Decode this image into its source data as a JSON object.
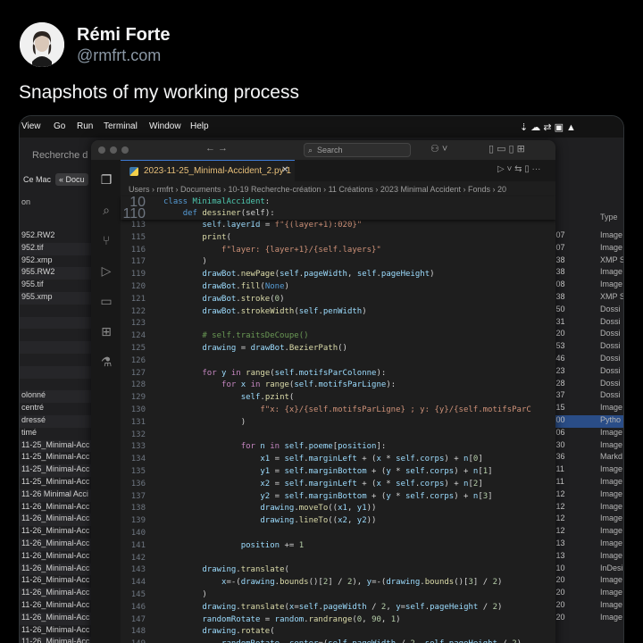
{
  "tweet": {
    "author_name": "Rémi Forte",
    "author_handle": "@rmfrt.com",
    "text": "Snapshots of my working process"
  },
  "menubar": {
    "items": [
      "View",
      "Go",
      "Run",
      "Terminal",
      "Window",
      "Help"
    ]
  },
  "finder": {
    "title": "Recherche d",
    "location_mac": "Ce Mac",
    "location_doc": "« Docu",
    "column_partial": "on",
    "type_header": "Type",
    "names": [
      "952.RW2",
      "952.tif",
      "952.xmp",
      "955.RW2",
      "955.tif",
      "955.xmp",
      "",
      "",
      "",
      "",
      "",
      "",
      "",
      "olonné",
      "centré",
      "dressé",
      "timé",
      "11-25_Minimal-Acc",
      "11-25_Minimal-Acc",
      "11-25_Minimal-Acc",
      "11-25_Minimal-Acc",
      "11-26 Minimal Acci",
      "11-26_Minimal-Acc",
      "11-26_Minimal-Acc",
      "11-26_Minimal-Acc",
      "11-26_Minimal-Acc",
      "11-26_Minimal-Acc",
      "11-26_Minimal-Acc",
      "11-26_Minimal-Acc",
      "11-26_Minimal-Acc",
      "11-26_Minimal-Acc",
      "11-26_Minimal-Acc",
      "11-26_Minimal-Acc",
      "11-26_Minimal-Acc",
      "11-26_Minimal-Acc"
    ],
    "times": [
      ":07",
      ":07",
      ":38",
      ":38",
      ":08",
      ":38",
      ":50",
      ":31",
      ":20",
      ":53",
      ":46",
      ":23",
      ":28",
      ":37",
      ":15",
      ":00",
      ":06",
      ":30",
      ":36",
      ":11",
      ":11",
      ":12",
      ":12",
      ":12",
      ":12",
      ":13",
      ":13",
      ":10",
      ":20",
      ":20",
      ":20",
      ":20"
    ],
    "types": [
      "Image",
      "Image",
      "XMP S",
      "Image",
      "Image",
      "XMP S",
      "Dossi",
      "Dossi",
      "Dossi",
      "Dossi",
      "Dossi",
      "Dossi",
      "Dossi",
      "Dossi",
      "Image",
      "Pytho",
      "Image",
      "Image",
      "Markd",
      "Image",
      "Image",
      "Image",
      "Image",
      "Image",
      "Image",
      "Image",
      "Image",
      "InDesi",
      "Image",
      "Image",
      "Image",
      "Image"
    ]
  },
  "vscode": {
    "search_placeholder": "Search",
    "tab_label": "2023-11-25_Minimal-Accident_2.py 1",
    "breadcrumb": "Users › rmfrt › Documents › 10-19 Recherche-création › 11 Créations › 2023 Minimal Accident › Fonds › 20",
    "sticky": [
      {
        "n": "10",
        "code": "class MinimalAccident:"
      },
      {
        "n": "110",
        "code": "    def dessiner(self):"
      }
    ],
    "lines": [
      {
        "n": "113",
        "code": "        self.layerId = f\"{(layer+1):020}\""
      },
      {
        "n": "115",
        "code": "        print("
      },
      {
        "n": "116",
        "code": "            f\"layer: {layer+1}/{self.layers}\""
      },
      {
        "n": "117",
        "code": "        )"
      },
      {
        "n": "119",
        "code": "        drawBot.newPage(self.pageWidth, self.pageHeight)"
      },
      {
        "n": "120",
        "code": "        drawBot.fill(None)"
      },
      {
        "n": "121",
        "code": "        drawBot.stroke(0)"
      },
      {
        "n": "122",
        "code": "        drawBot.strokeWidth(self.penWidth)"
      },
      {
        "n": "123",
        "code": ""
      },
      {
        "n": "124",
        "code": "        # self.traitsDeCoupe()"
      },
      {
        "n": "125",
        "code": "        drawing = drawBot.BezierPath()"
      },
      {
        "n": "126",
        "code": ""
      },
      {
        "n": "127",
        "code": "        for y in range(self.motifsParColonne):"
      },
      {
        "n": "128",
        "code": "            for x in range(self.motifsParLigne):"
      },
      {
        "n": "129",
        "code": "                self.pzint("
      },
      {
        "n": "130",
        "code": "                    f\"x: {x}/{self.motifsParLigne} ; y: {y}/{self.motifsParC"
      },
      {
        "n": "131",
        "code": "                )"
      },
      {
        "n": "132",
        "code": ""
      },
      {
        "n": "133",
        "code": "                for n in self.poeme[position]:"
      },
      {
        "n": "134",
        "code": "                    x1 = self.marginLeft + (x * self.corps) + n[0]"
      },
      {
        "n": "135",
        "code": "                    y1 = self.marginBottom + (y * self.corps) + n[1]"
      },
      {
        "n": "136",
        "code": "                    x2 = self.marginLeft + (x * self.corps) + n[2]"
      },
      {
        "n": "137",
        "code": "                    y2 = self.marginBottom + (y * self.corps) + n[3]"
      },
      {
        "n": "138",
        "code": "                    drawing.moveTo((x1, y1))"
      },
      {
        "n": "139",
        "code": "                    drawing.lineTo((x2, y2))"
      },
      {
        "n": "140",
        "code": ""
      },
      {
        "n": "141",
        "code": "                position += 1"
      },
      {
        "n": "142",
        "code": ""
      },
      {
        "n": "143",
        "code": "        drawing.translate("
      },
      {
        "n": "144",
        "code": "            x=-(drawing.bounds()[2] / 2), y=-(drawing.bounds()[3] / 2)"
      },
      {
        "n": "145",
        "code": "        )"
      },
      {
        "n": "146",
        "code": "        drawing.translate(x=self.pageWidth / 2, y=self.pageHeight / 2)"
      },
      {
        "n": "147",
        "code": "        randomRotate = random.randrange(0, 90, 1)"
      },
      {
        "n": "148",
        "code": "        drawing.rotate("
      },
      {
        "n": "149",
        "code": "            randomRotate, center=(self.pageWidth / 2, self.pageHeight / 2)"
      }
    ]
  }
}
